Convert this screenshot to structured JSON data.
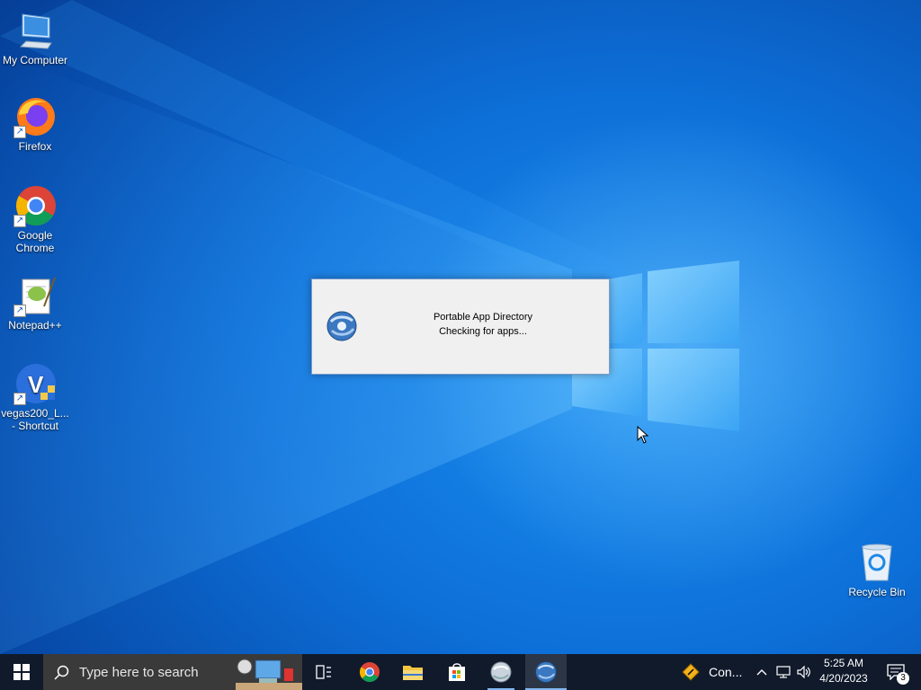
{
  "desktop_icons": [
    {
      "label": "My Computer",
      "icon": "computer-icon"
    },
    {
      "label": "Firefox",
      "icon": "firefox-icon"
    },
    {
      "label": "Google Chrome",
      "icon": "chrome-icon"
    },
    {
      "label": "Notepad++",
      "icon": "notepadpp-icon"
    },
    {
      "label": "vegas200_L...\n- Shortcut",
      "icon": "vegas-icon"
    },
    {
      "label": "Recycle Bin",
      "icon": "recycle-bin-icon"
    }
  ],
  "dialog": {
    "title_line": "Portable App Directory",
    "status_line": "Checking for apps..."
  },
  "taskbar": {
    "search_placeholder": "Type here to search",
    "tray_item": "Con...",
    "time": "5:25 AM",
    "date": "4/20/2023",
    "notification_count": "3"
  },
  "colors": {
    "desktop": "#0d6fd8",
    "taskbar": "#101a2b",
    "dialog": "#f0f0f0"
  }
}
